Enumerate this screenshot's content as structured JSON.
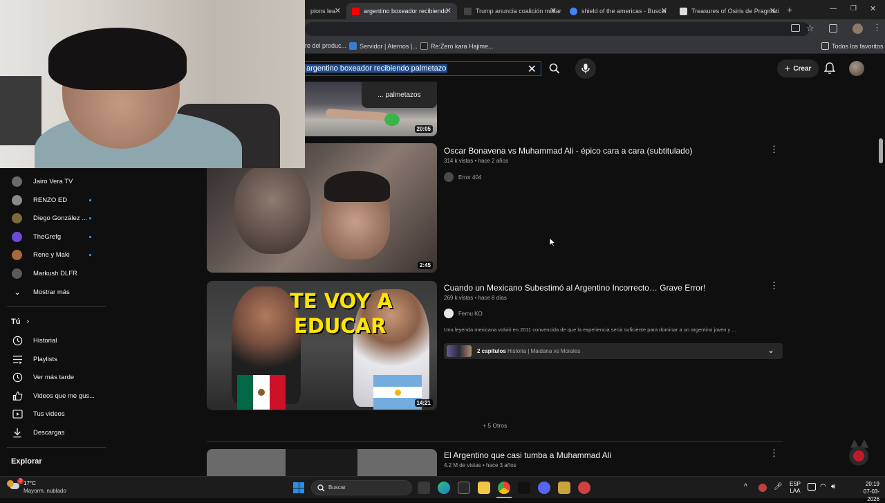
{
  "browser": {
    "tabs": [
      {
        "label": "pions lea",
        "active": false
      },
      {
        "label": "argentino boxeador recibiendo",
        "active": true
      },
      {
        "label": "Trump anuncia coalición militar",
        "active": false
      },
      {
        "label": "shield of the americas - Buscar",
        "active": false
      },
      {
        "label": "Treasures of Osiris de Pragmati",
        "active": false
      }
    ],
    "new_tab": "+",
    "bookmarks": [
      {
        "label": "re del produc..."
      },
      {
        "label": "Servidor | Aternos |..."
      },
      {
        "label": "Re:Zero kara Hajime..."
      }
    ],
    "all_favorites": "Todos los favoritos"
  },
  "header": {
    "search_value": "argentino  boxeador recibiendo palmetazo",
    "create_label": "Crear"
  },
  "sidebar": {
    "subscriptions": [
      {
        "label": "Jairo Vera TV",
        "dot": false,
        "color": "#6a6a6a"
      },
      {
        "label": "RENZO ED",
        "dot": true,
        "color": "#8a8a8a"
      },
      {
        "label": "Diego González ...",
        "dot": true,
        "color": "#7d6a3a"
      },
      {
        "label": "TheGrefg",
        "dot": true,
        "color": "#6b4bd6"
      },
      {
        "label": "Rene y Maki",
        "dot": true,
        "color": "#a8673c"
      },
      {
        "label": "Markush DLFR",
        "dot": false,
        "color": "#5a5a5a"
      }
    ],
    "show_more": "Mostrar más",
    "you_heading": "Tú",
    "you_items": [
      {
        "label": "Historial",
        "icon": "history-icon"
      },
      {
        "label": "Playlists",
        "icon": "playlists-icon"
      },
      {
        "label": "Ver más tarde",
        "icon": "watch-later-icon"
      },
      {
        "label": "Videos que me gus...",
        "icon": "liked-icon"
      },
      {
        "label": "Tus videos",
        "icon": "your-videos-icon"
      },
      {
        "label": "Descargas",
        "icon": "downloads-icon"
      }
    ],
    "explore_heading": "Explorar"
  },
  "results": {
    "top_thumb": {
      "overlay_text": "... palmetazos",
      "duration": "20:05"
    },
    "videos": [
      {
        "title": "Oscar Bonavena vs Muhammad Ali - épico cara a cara (subtitulado)",
        "meta": "314 k vistas  •  hace 2 años",
        "channel": "Error 404",
        "duration": "2:45"
      },
      {
        "title": "Cuando un Mexicano Subestimó al Argentino Incorrecto… Grave Error!",
        "meta": "269 k vistas  •  hace 8 días",
        "channel": "Fernu KO",
        "description": "Una leyenda mexicana volvió en 2011 convencida de que la experiencia sería suficiente para dominar a un argentino joven y ...",
        "chapters_label": "2 capítulos",
        "chapters_text": "Historia | Maidana vs Morales",
        "duration": "14:21",
        "thumb_text_line1": "TE VOY A",
        "thumb_text_line2": "EDUCAR"
      },
      {
        "title": "El Argentino que casi tumba a Muhammad Ali",
        "meta": "4.2 M de vistas  •  hace 3 años"
      }
    ],
    "more_label": "+ 5 Otros"
  },
  "taskbar": {
    "weather_temp": "17°C",
    "weather_desc": "Mayorm. nublado",
    "search_placeholder": "Buscar",
    "lang_line1": "ESP",
    "lang_line2": "LAA",
    "time": "20:19",
    "date": "07-03-2026",
    "badge": "3"
  }
}
